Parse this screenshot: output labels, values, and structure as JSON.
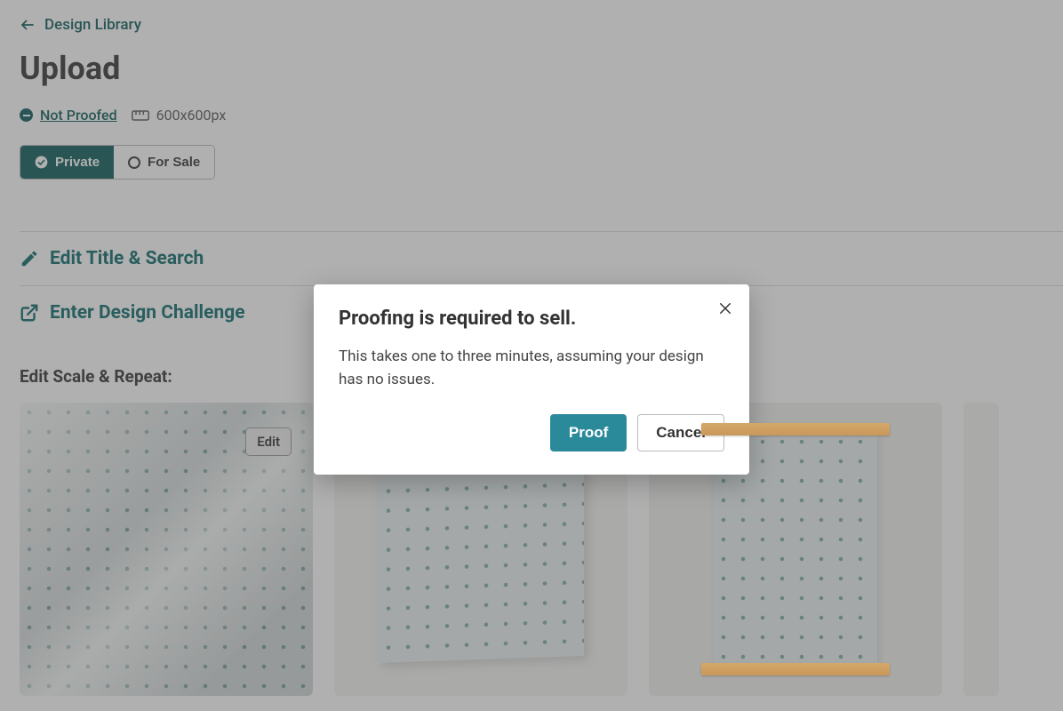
{
  "breadcrumb": {
    "label": "Design Library"
  },
  "page": {
    "title": "Upload"
  },
  "meta": {
    "proof_status": "Not Proofed",
    "dimensions": "600x600px"
  },
  "visibility": {
    "private_label": "Private",
    "for_sale_label": "For Sale",
    "selected": "private"
  },
  "sections": {
    "edit_title": "Edit Title & Search",
    "enter_challenge": "Enter Design Challenge"
  },
  "scale_heading": "Edit Scale & Repeat:",
  "preview": {
    "edit_label": "Edit"
  },
  "modal": {
    "title": "Proofing is required to sell.",
    "body": "This takes one to three minutes, assuming your design has no issues.",
    "primary": "Proof",
    "secondary": "Cancel"
  }
}
